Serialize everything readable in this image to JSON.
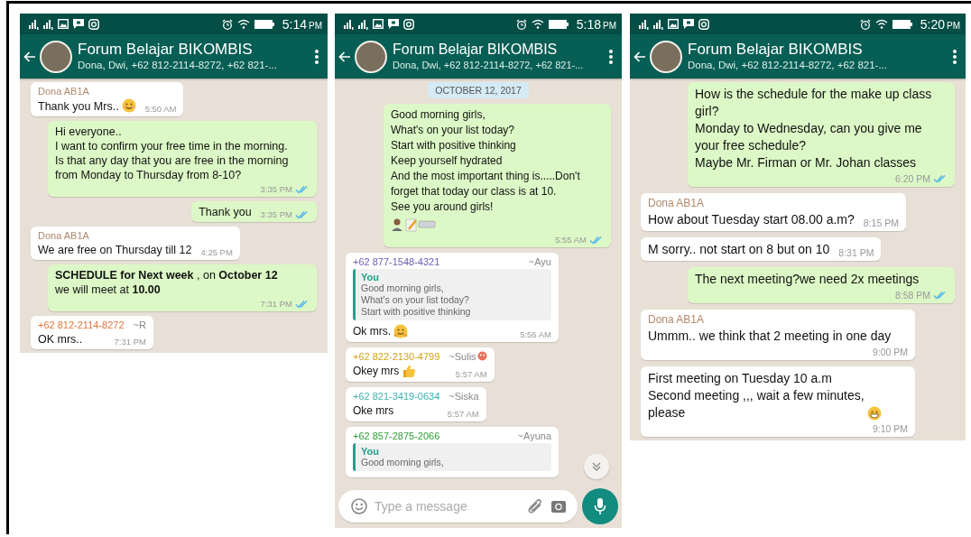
{
  "screens": [
    {
      "status_bar": {
        "time": "5:14",
        "ampm": "PM"
      },
      "header": {
        "title": "Forum Belajar BIKOMBIS",
        "subtitle": "Dona, Dwi, +62 812-2114-8272, +62 821-..."
      },
      "messages": [
        {
          "kind": "in",
          "sender": "Dona AB1A",
          "color": "#b0896c",
          "text": "Thank you Mrs..",
          "emoji": {
            "kind": "smile"
          },
          "time": "5:50 AM"
        },
        {
          "kind": "out",
          "text": "Hi everyone..\nI want to confirm your free time in the morning.\nIs that any day that you are free in the morning from Monday to Thursday from 8-10?",
          "time": "3:35 PM",
          "read": true
        },
        {
          "kind": "out",
          "text": "Thank you",
          "time": "3:35 PM",
          "read": true
        },
        {
          "kind": "in",
          "sender": "Dona AB1A",
          "color": "#b0896c",
          "text": "We are free on Thursday till 12",
          "time": "4:25 PM"
        },
        {
          "kind": "out",
          "text": "**SCHEDULE for Next week** , on **October 12**\nwe will meet at **10.00**",
          "time": "7:31 PM",
          "read": true
        },
        {
          "kind": "in",
          "sender": "+62 812-2114-8272",
          "color": "#e0763a",
          "alias": "~R",
          "text": "OK mrs..",
          "time": "7:31 PM"
        }
      ]
    },
    {
      "status_bar": {
        "time": "5:18",
        "ampm": "PM"
      },
      "header": {
        "title": "Forum Belajar BIKOMBIS",
        "subtitle": "Dona, Dwi, +62 812-2114-8272, +62 821-..."
      },
      "messages": [
        {
          "kind": "date",
          "text": "OCTOBER 12, 2017"
        },
        {
          "kind": "out",
          "text": "Good morning girls,\nWhat's on your list today?\nStart with positive thinking\nKeep yourself hydrated\nAnd the most important thing is.....Don't forget that today our class is at 10.\nSee you around girls!",
          "emoji": {
            "kind": "office"
          },
          "time": "5:55 AM",
          "read": true
        },
        {
          "kind": "in",
          "sender": "+62 877-1548-4321",
          "color": "#6a5fb0",
          "alias": "~Ayu",
          "quote": {
            "author": "You",
            "text": "Good morning girls,\nWhat's on your list today?\nStart with positive thinking"
          },
          "text": "Ok mrs.",
          "emoji": {
            "kind": "hug"
          },
          "time": "5:56 AM"
        },
        {
          "kind": "in",
          "sender": "+62 822-2130-4799",
          "color": "#d1a21c",
          "alias": "~Sulis",
          "alias_emoji": {
            "kind": "face"
          },
          "text": "Okey mrs",
          "emoji": {
            "kind": "thumbs"
          },
          "time": "5:57 AM"
        },
        {
          "kind": "in",
          "sender": "+62 821-3419-0634",
          "color": "#3cb3b0",
          "alias": "~Siska",
          "text": "Oke mrs",
          "time": "5:57 AM"
        },
        {
          "kind": "in",
          "sender": "+62 857-2875-2066",
          "color": "#2f9e36",
          "alias": "~Ayuna",
          "quote": {
            "author": "You",
            "text": "Good morning girls,"
          }
        }
      ],
      "scroll_down_button": true,
      "input": {
        "placeholder": "Type a message"
      }
    },
    {
      "status_bar": {
        "time": "5:20",
        "ampm": "PM"
      },
      "header": {
        "title": "Forum Belajar BIKOMBIS",
        "subtitle": "Dona, Dwi, +62 812-2114-8272, +62 821-..."
      },
      "messages": [
        {
          "kind": "out",
          "text": "How is the schedule for the make up class girl?\nMonday to Wednesday, can you give me your free schedule?\nMaybe Mr. Firman or Mr. Johan classes",
          "time": "6:20 PM",
          "read": true
        },
        {
          "kind": "in",
          "sender": "Dona AB1A",
          "color": "#b0896c",
          "text": "How about Tuesday start 08.00 a.m?",
          "time": "8:15 PM"
        },
        {
          "kind": "in",
          "text": "M sorry.. not start on 8 but on 10",
          "time": "8:31 PM"
        },
        {
          "kind": "out",
          "text": "The next meeting?we need 2x meetings",
          "time": "8:58 PM",
          "read": true
        },
        {
          "kind": "in",
          "sender": "Dona AB1A",
          "color": "#b0896c",
          "text": "Ummm.. we think that 2 meeting in one day",
          "time": "9:00 PM"
        },
        {
          "kind": "in",
          "text": "First meeting on Tuesday 10 a.m\nSecond meeting ,,, wait a few minutes,\nplease",
          "emoji": {
            "kind": "grin"
          },
          "time": "9:10 PM"
        }
      ]
    }
  ]
}
